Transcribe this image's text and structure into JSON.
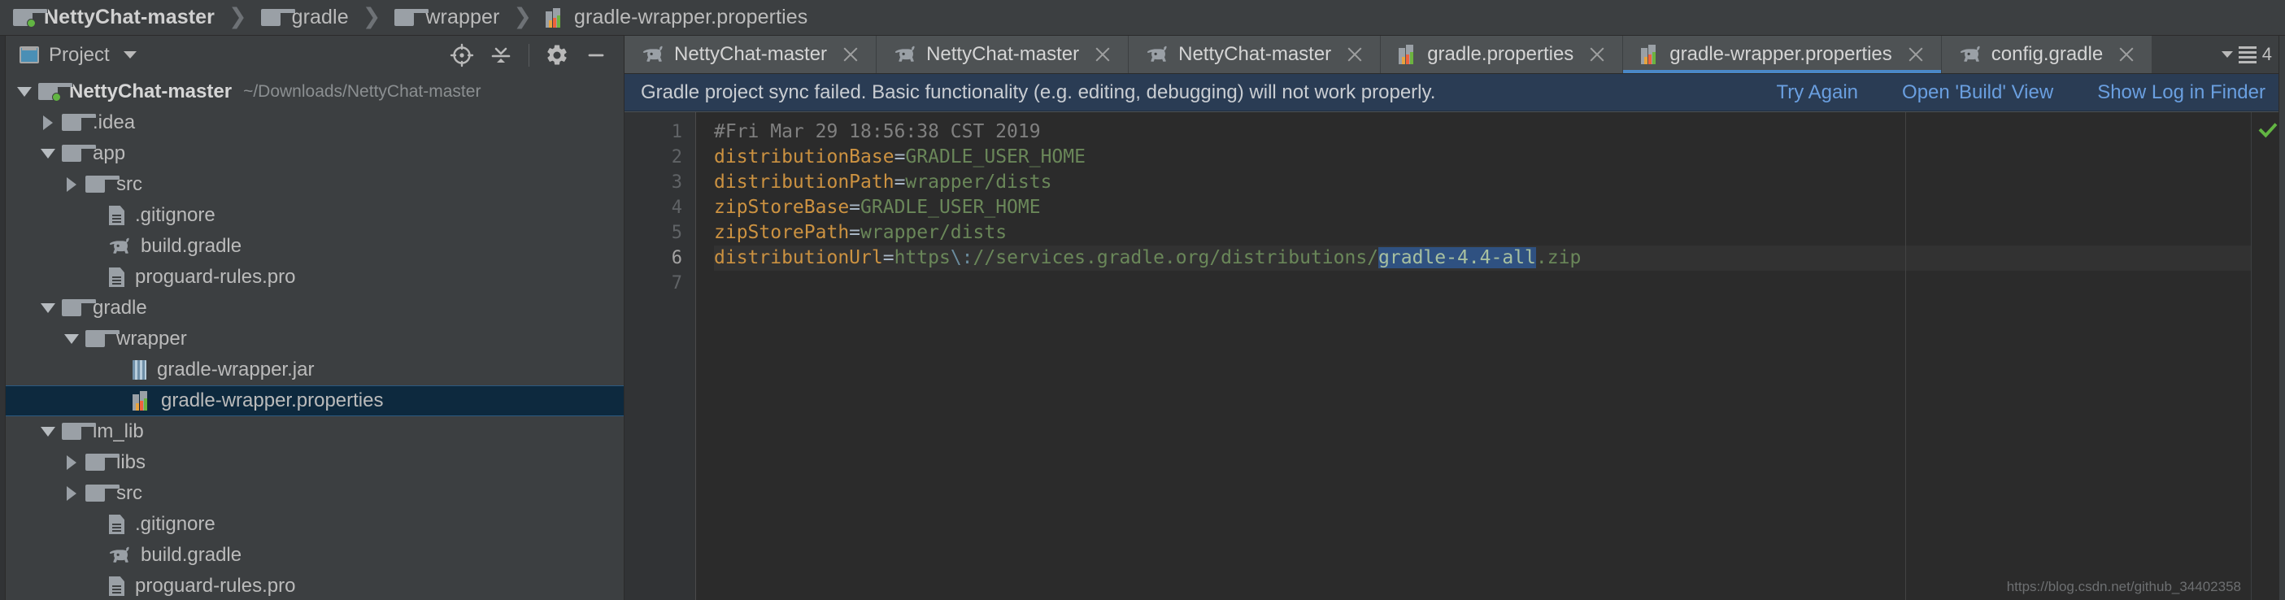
{
  "breadcrumb": {
    "items": [
      {
        "label": "NettyChat-master",
        "icon": "module-icon",
        "root": true
      },
      {
        "label": "gradle",
        "icon": "folder-icon",
        "root": false
      },
      {
        "label": "wrapper",
        "icon": "folder-icon",
        "root": false
      },
      {
        "label": "gradle-wrapper.properties",
        "icon": "properties-icon",
        "root": false
      }
    ],
    "separator": "❯"
  },
  "project_panel": {
    "title": "Project",
    "toolbar_icons": [
      "locate-icon",
      "collapse-all-icon",
      "settings-gear-icon",
      "hide-icon"
    ],
    "tree": [
      {
        "label": "NettyChat-master",
        "path": "~/Downloads/NettyChat-master",
        "icon": "module-icon",
        "twisty": "down",
        "indent": 0,
        "bold": true,
        "selected": false
      },
      {
        "label": ".idea",
        "path": "",
        "icon": "folder-icon",
        "twisty": "right",
        "indent": 1,
        "bold": false,
        "selected": false
      },
      {
        "label": "app",
        "path": "",
        "icon": "folder-icon",
        "twisty": "down",
        "indent": 1,
        "bold": false,
        "selected": false
      },
      {
        "label": "src",
        "path": "",
        "icon": "folder-icon",
        "twisty": "right",
        "indent": 2,
        "bold": false,
        "selected": false
      },
      {
        "label": ".gitignore",
        "path": "",
        "icon": "file-icon",
        "twisty": "none",
        "indent": 3,
        "bold": false,
        "selected": false
      },
      {
        "label": "build.gradle",
        "path": "",
        "icon": "gradle-icon",
        "twisty": "none",
        "indent": 3,
        "bold": false,
        "selected": false
      },
      {
        "label": "proguard-rules.pro",
        "path": "",
        "icon": "file-icon",
        "twisty": "none",
        "indent": 3,
        "bold": false,
        "selected": false
      },
      {
        "label": "gradle",
        "path": "",
        "icon": "folder-icon",
        "twisty": "down",
        "indent": 1,
        "bold": false,
        "selected": false
      },
      {
        "label": "wrapper",
        "path": "",
        "icon": "folder-icon",
        "twisty": "down",
        "indent": 2,
        "bold": false,
        "selected": false
      },
      {
        "label": "gradle-wrapper.jar",
        "path": "",
        "icon": "jar-icon",
        "twisty": "none",
        "indent": 4,
        "bold": false,
        "selected": false
      },
      {
        "label": "gradle-wrapper.properties",
        "path": "",
        "icon": "properties-icon",
        "twisty": "none",
        "indent": 4,
        "bold": false,
        "selected": true
      },
      {
        "label": "im_lib",
        "path": "",
        "icon": "folder-icon",
        "twisty": "down",
        "indent": 1,
        "bold": false,
        "selected": false
      },
      {
        "label": "libs",
        "path": "",
        "icon": "folder-icon",
        "twisty": "right",
        "indent": 2,
        "bold": false,
        "selected": false
      },
      {
        "label": "src",
        "path": "",
        "icon": "folder-icon",
        "twisty": "right",
        "indent": 2,
        "bold": false,
        "selected": false
      },
      {
        "label": ".gitignore",
        "path": "",
        "icon": "file-icon",
        "twisty": "none",
        "indent": 3,
        "bold": false,
        "selected": false
      },
      {
        "label": "build.gradle",
        "path": "",
        "icon": "gradle-icon",
        "twisty": "none",
        "indent": 3,
        "bold": false,
        "selected": false
      },
      {
        "label": "proguard-rules.pro",
        "path": "",
        "icon": "file-icon",
        "twisty": "none",
        "indent": 3,
        "bold": false,
        "selected": false
      }
    ]
  },
  "editor_tabs": {
    "tabs": [
      {
        "label": "NettyChat-master",
        "icon": "gradle-icon",
        "active": false
      },
      {
        "label": "NettyChat-master",
        "icon": "gradle-icon",
        "active": false
      },
      {
        "label": "NettyChat-master",
        "icon": "gradle-icon",
        "active": false
      },
      {
        "label": "gradle.properties",
        "icon": "properties-icon",
        "active": false
      },
      {
        "label": "gradle-wrapper.properties",
        "icon": "properties-icon",
        "active": true
      },
      {
        "label": "config.gradle",
        "icon": "gradle-icon",
        "active": false
      }
    ],
    "overflow_count": "4"
  },
  "notification": {
    "message": "Gradle project sync failed. Basic functionality (e.g. editing, debugging) will not work properly.",
    "links": [
      "Try Again",
      "Open 'Build' View",
      "Show Log in Finder"
    ],
    "background": "#2a3c54",
    "link_color": "#6a9fe0"
  },
  "editor": {
    "line_numbers": [
      "1",
      "2",
      "3",
      "4",
      "5",
      "6",
      "7"
    ],
    "current_line": 6,
    "lines": [
      {
        "n": 1,
        "tokens": [
          {
            "t": "#Fri Mar 29 18:56:38 CST 2019",
            "c": "t-comment"
          }
        ]
      },
      {
        "n": 2,
        "tokens": [
          {
            "t": "distributionBase",
            "c": "t-key"
          },
          {
            "t": "=",
            "c": "t-eq"
          },
          {
            "t": "GRADLE_USER_HOME",
            "c": "t-val"
          }
        ]
      },
      {
        "n": 3,
        "tokens": [
          {
            "t": "distributionPath",
            "c": "t-key"
          },
          {
            "t": "=",
            "c": "t-eq"
          },
          {
            "t": "wrapper/dists",
            "c": "t-val"
          }
        ]
      },
      {
        "n": 4,
        "tokens": [
          {
            "t": "zipStoreBase",
            "c": "t-key"
          },
          {
            "t": "=",
            "c": "t-eq"
          },
          {
            "t": "GRADLE_USER_HOME",
            "c": "t-val"
          }
        ]
      },
      {
        "n": 5,
        "tokens": [
          {
            "t": "zipStorePath",
            "c": "t-key"
          },
          {
            "t": "=",
            "c": "t-eq"
          },
          {
            "t": "wrapper/dists",
            "c": "t-val"
          }
        ]
      },
      {
        "n": 6,
        "tokens": [
          {
            "t": "distributionUrl",
            "c": "t-key"
          },
          {
            "t": "=",
            "c": "t-eq"
          },
          {
            "t": "https",
            "c": "t-val"
          },
          {
            "t": "\\:",
            "c": "t-esc"
          },
          {
            "t": "//services.gradle.org/distributions/",
            "c": "t-val"
          },
          {
            "t": "gradle-4.4-all",
            "c": "t-sel"
          },
          {
            "t": ".zip",
            "c": "t-val"
          }
        ]
      },
      {
        "n": 7,
        "tokens": [
          {
            "t": "",
            "c": "t-val"
          }
        ]
      }
    ],
    "status_marker": "inspection-ok-check",
    "watermark": "https://blog.csdn.net/github_34402358"
  },
  "colors": {
    "panel_bg": "#3c3f41",
    "editor_bg": "#2b2b2b",
    "selection_blue": "#2f5181",
    "tab_active_underline": "#4a88c7",
    "tree_selected_bg": "#0d293e",
    "key_orange": "#cc9241",
    "value_green": "#6a8759",
    "comment_gray": "#808080",
    "ok_green": "#62b543"
  }
}
